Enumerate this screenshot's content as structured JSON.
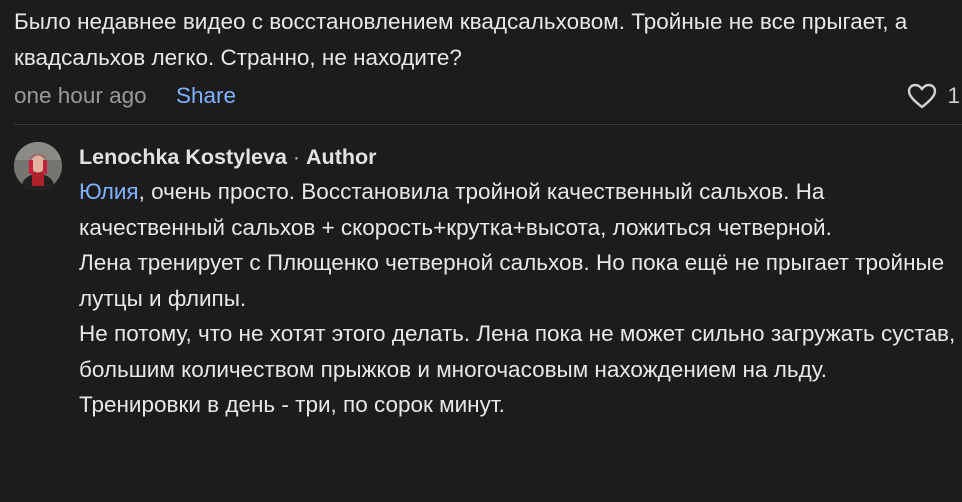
{
  "top_comment": {
    "text": "Было недавнее видео с восстановлением квадсальховом. Тройные не все прыгает, а квадсальхов легко. Странно, не находите?",
    "time": "one hour ago",
    "share_label": "Share",
    "like_count": "1"
  },
  "reply": {
    "author": "Lenochka Kostyleva",
    "separator": " · ",
    "author_tag": "Author",
    "mention": "Юлия",
    "paragraphs": [
      ", очень просто. Восстановила тройной качественный сальхов. На качественный сальхов + скорость+крутка+высота, ложиться четверной.",
      "Лена тренирует с Плющенко четверной сальхов. Но пока ещё не прыгает тройные лутцы и флипы.",
      "Не потому, что не хотят этого делать. Лена пока не может сильно загружать сустав, большим количеством прыжков и многочасовым нахождением на льду.",
      "Тренировки в день - три, по сорок минут."
    ]
  },
  "colors": {
    "background": "#1c1c1c",
    "link": "#7fb2ff",
    "muted": "#9a9a9a"
  }
}
